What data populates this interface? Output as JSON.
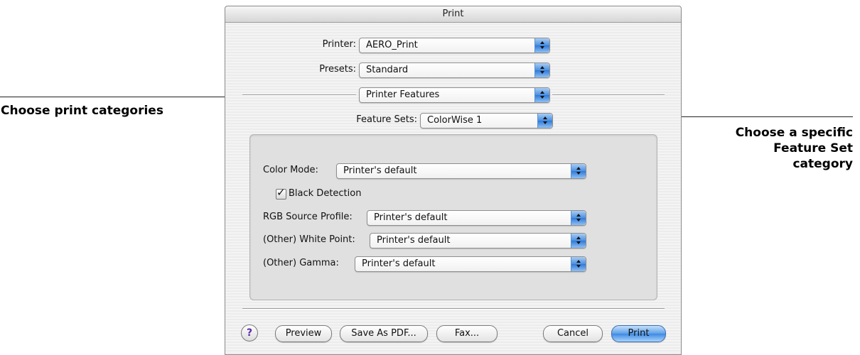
{
  "window": {
    "title": "Print"
  },
  "printer": {
    "label": "Printer:",
    "value": "AERO_Print"
  },
  "presets": {
    "label": "Presets:",
    "value": "Standard"
  },
  "category": {
    "value": "Printer Features"
  },
  "feature_sets": {
    "label": "Feature Sets:",
    "value": "ColorWise 1"
  },
  "options": {
    "color_mode": {
      "label": "Color Mode:",
      "value": "Printer's default"
    },
    "black_detection": {
      "label": "Black Detection",
      "checked": true
    },
    "rgb_source_profile": {
      "label": "RGB Source Profile:",
      "value": "Printer's default"
    },
    "white_point": {
      "label": "(Other) White Point:",
      "value": "Printer's default"
    },
    "gamma": {
      "label": "(Other) Gamma:",
      "value": "Printer's default"
    }
  },
  "buttons": {
    "help": "?",
    "preview": "Preview",
    "save_pdf": "Save As PDF...",
    "fax": "Fax...",
    "cancel": "Cancel",
    "print": "Print"
  },
  "callouts": {
    "left": "Choose print categories",
    "right": [
      "Choose a specific",
      "Feature Set",
      "category"
    ]
  },
  "colors": {
    "accent": "#3d8ae3",
    "help_icon": "#5a2aa8"
  }
}
